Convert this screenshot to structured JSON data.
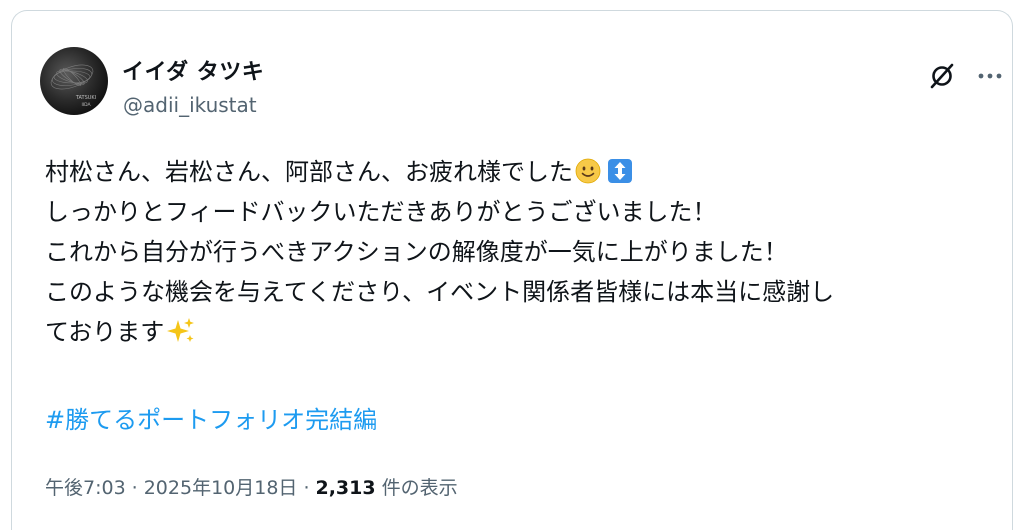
{
  "author": {
    "display_name": "イイダ タツキ",
    "handle": "@adii_ikustat",
    "avatar_text_line1": "TATSUKI",
    "avatar_text_line2": "IIDA"
  },
  "tweet": {
    "lines": [
      "村松さん、岩松さん、阿部さん、お疲れ様でした",
      "しっかりとフィードバックいただきありがとうございました！",
      "これから自分が行うべきアクションの解像度が一気に上がりました！",
      "このような機会を与えてくださり、イベント関係者皆様には本当に感謝し",
      "ております"
    ],
    "emoji": {
      "line1_end": [
        "slightly-smiling-face-emoji",
        "up-down-arrow-emoji"
      ],
      "line5_end": [
        "sparkles-emoji"
      ]
    },
    "hashtag": "#勝てるポートフォリオ完結編"
  },
  "meta": {
    "time": "午後7:03",
    "separator": "·",
    "date": "2025年10月18日",
    "views_count": "2,313",
    "views_label": "件の表示"
  },
  "colors": {
    "text_primary": "#0f1419",
    "text_secondary": "#536471",
    "link": "#1d9bf0",
    "border": "#cfd9de"
  },
  "icons": {
    "grok": "grok-icon",
    "more": "more-icon"
  }
}
